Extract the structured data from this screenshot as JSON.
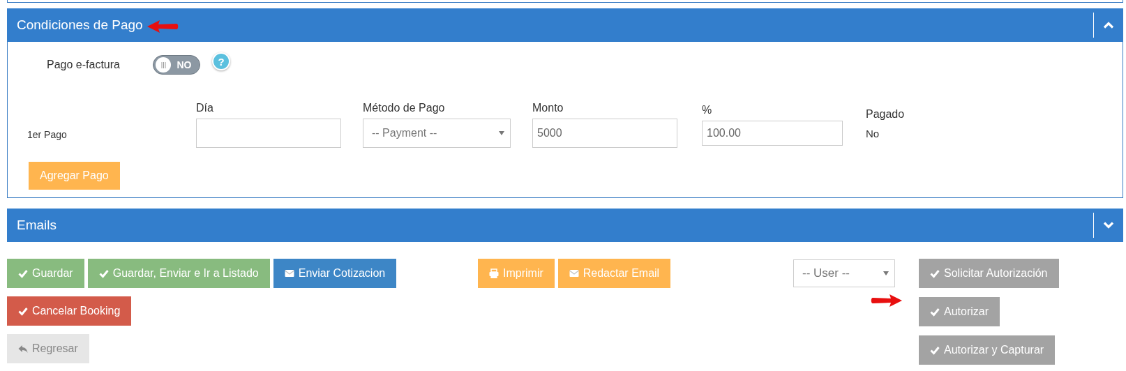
{
  "sections": [
    {
      "title": "Condiciones de Pago",
      "expanded": true,
      "arrow": true,
      "toggle": {
        "label": "Pago e-factura",
        "on": false,
        "text": "NO"
      },
      "help": "?",
      "columns": [
        "Día",
        "Método de Pago",
        "Monto",
        "%",
        "Pagado"
      ],
      "payments": [
        {
          "label": "1er Pago",
          "method_placeholder": "-- Payment --",
          "amount": "5000",
          "percent": "100.00",
          "paid": "No"
        }
      ],
      "add_button": "Agregar Pago"
    },
    {
      "title": "Emails",
      "expanded": false,
      "arrow": false
    }
  ],
  "actions": {
    "main": [
      [
        {
          "label": "Guardar",
          "kind": "success"
        },
        {
          "label": "Guardar, Enviar e Ir a Listado",
          "kind": "success"
        },
        {
          "label": "Enviar Cotizacion",
          "kind": "primary"
        }
      ],
      [
        {
          "label": "Cancelar Booking",
          "kind": "danger"
        }
      ],
      [
        {
          "label": "Regresar",
          "kind": "light",
          "disabled": true
        }
      ]
    ],
    "print": [
      {
        "label": "Imprimir",
        "kind": "warning"
      },
      {
        "label": "Redactar Email",
        "kind": "warning"
      }
    ],
    "user_select": {
      "placeholder": "-- User --"
    },
    "auth": [
      {
        "label": "Solicitar Autorización",
        "kind": "gray",
        "arrow": false
      },
      {
        "label": "Autorizar",
        "kind": "gray",
        "arrow": true
      },
      {
        "label": "Autorizar y Capturar",
        "kind": "gray",
        "arrow": false
      }
    ]
  }
}
